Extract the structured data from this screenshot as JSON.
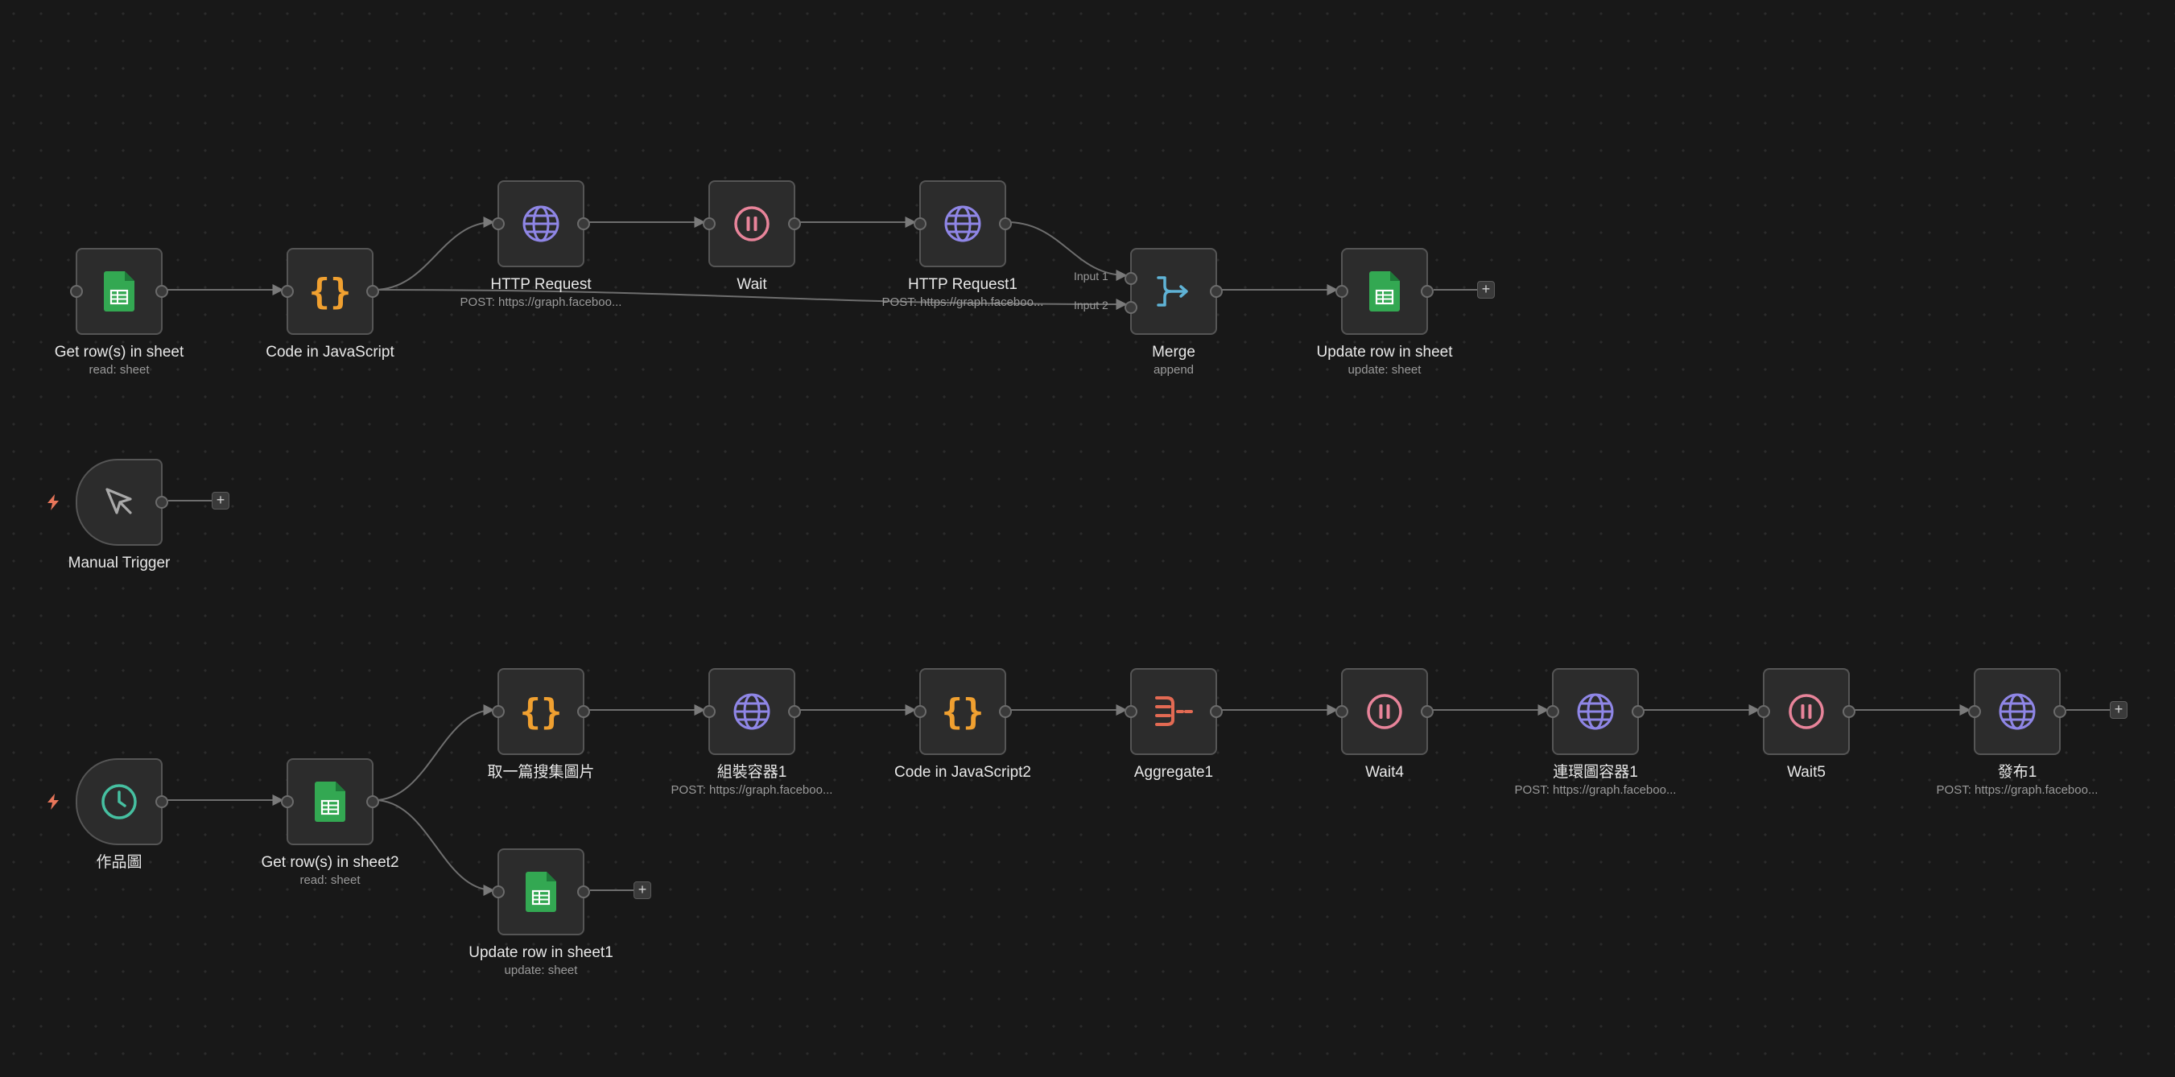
{
  "canvas": {
    "background": "#181818"
  },
  "colors": {
    "sheets_green": "#33a852",
    "code_orange": "#f0a030",
    "http_purple": "#8f86e6",
    "wait_pink": "#e8849a",
    "merge_blue": "#5fb3d6",
    "aggregate_red": "#e36a53",
    "schedule_teal": "#46c0a1",
    "trigger_bolt": "#e8765a"
  },
  "nodes": [
    {
      "id": "n1",
      "label": "Get row(s) in sheet",
      "sub": "read: sheet",
      "icon": "google-sheets-icon"
    },
    {
      "id": "n2",
      "label": "Code in JavaScript",
      "sub": "",
      "icon": "code-braces-icon"
    },
    {
      "id": "n3",
      "label": "HTTP Request",
      "sub": "POST: https://graph.faceboo...",
      "icon": "globe-icon"
    },
    {
      "id": "n4",
      "label": "Wait",
      "sub": "",
      "icon": "pause-icon"
    },
    {
      "id": "n5",
      "label": "HTTP Request1",
      "sub": "POST: https://graph.faceboo...",
      "icon": "globe-icon"
    },
    {
      "id": "n6",
      "label": "Merge",
      "sub": "append",
      "icon": "merge-icon",
      "inputs": [
        "Input 1",
        "Input 2"
      ]
    },
    {
      "id": "n7",
      "label": "Update row in sheet",
      "sub": "update: sheet",
      "icon": "google-sheets-icon"
    },
    {
      "id": "n8",
      "label": "Manual Trigger",
      "sub": "",
      "icon": "cursor-icon"
    },
    {
      "id": "n9",
      "label": "作品圖",
      "sub": "",
      "icon": "clock-icon"
    },
    {
      "id": "n10",
      "label": "Get row(s) in sheet2",
      "sub": "read: sheet",
      "icon": "google-sheets-icon"
    },
    {
      "id": "n11",
      "label": "取一篇搜集圖片",
      "sub": "",
      "icon": "code-braces-icon"
    },
    {
      "id": "n12",
      "label": "Update row in sheet1",
      "sub": "update: sheet",
      "icon": "google-sheets-icon"
    },
    {
      "id": "n13",
      "label": "組裝容器1",
      "sub": "POST: https://graph.faceboo...",
      "icon": "globe-icon"
    },
    {
      "id": "n14",
      "label": "Code in JavaScript2",
      "sub": "",
      "icon": "code-braces-icon"
    },
    {
      "id": "n15",
      "label": "Aggregate1",
      "sub": "",
      "icon": "aggregate-icon"
    },
    {
      "id": "n16",
      "label": "Wait4",
      "sub": "",
      "icon": "pause-icon"
    },
    {
      "id": "n17",
      "label": "連環圖容器1",
      "sub": "POST: https://graph.faceboo...",
      "icon": "globe-icon"
    },
    {
      "id": "n18",
      "label": "Wait5",
      "sub": "",
      "icon": "pause-icon"
    },
    {
      "id": "n19",
      "label": "發布1",
      "sub": "POST: https://graph.faceboo...",
      "icon": "globe-icon"
    }
  ],
  "connections": [
    [
      "n1",
      "n2"
    ],
    [
      "n2",
      "n3"
    ],
    [
      "n2",
      "n6"
    ],
    [
      "n3",
      "n4"
    ],
    [
      "n4",
      "n5"
    ],
    [
      "n5",
      "n6"
    ],
    [
      "n6",
      "n7"
    ],
    [
      "n9",
      "n10"
    ],
    [
      "n10",
      "n11"
    ],
    [
      "n10",
      "n12"
    ],
    [
      "n11",
      "n13"
    ],
    [
      "n13",
      "n14"
    ],
    [
      "n14",
      "n15"
    ],
    [
      "n15",
      "n16"
    ],
    [
      "n16",
      "n17"
    ],
    [
      "n17",
      "n18"
    ],
    [
      "n18",
      "n19"
    ]
  ],
  "add_buttons": {
    "symbol": "+"
  }
}
